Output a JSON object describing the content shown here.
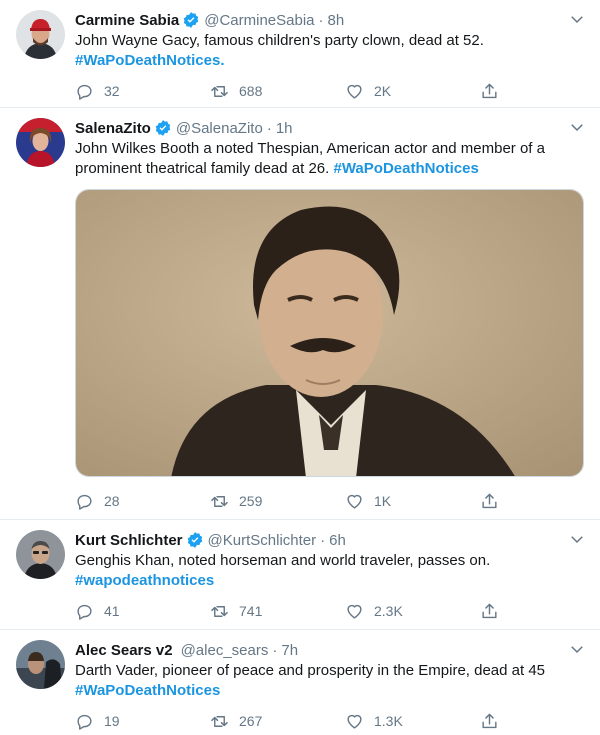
{
  "tweets": [
    {
      "name": "Carmine Sabia",
      "handle": "@CarmineSabia",
      "time": "8h",
      "text": "John Wayne Gacy, famous children's party clown, dead at 52.",
      "hashtag": "#WaPoDeathNotices",
      "hashtag_suffix": ".",
      "replies": "32",
      "retweets": "688",
      "likes": "2K"
    },
    {
      "name": "SalenaZito",
      "handle": "@SalenaZito",
      "time": "1h",
      "text": "John Wilkes Booth a noted Thespian, American actor and member of a prominent theatrical family dead at 26.",
      "hashtag": "#WaPoDeathNotices",
      "hashtag_suffix": "",
      "replies": "28",
      "retweets": "259",
      "likes": "1K"
    },
    {
      "name": "Kurt Schlichter",
      "handle": "@KurtSchlichter",
      "time": "6h",
      "text": "Genghis Khan, noted horseman and world traveler, passes on.",
      "hashtag": "#wapodeathnotices",
      "hashtag_suffix": "",
      "replies": "41",
      "retweets": "741",
      "likes": "2.3K"
    },
    {
      "name": "Alec Sears v2",
      "handle": "@alec_sears",
      "time": "7h",
      "text": "Darth Vader, pioneer of peace and prosperity in the Empire, dead at 45",
      "hashtag": "#WaPoDeathNotices",
      "hashtag_suffix": "",
      "replies": "19",
      "retweets": "267",
      "likes": "1.3K"
    }
  ],
  "separator": "·",
  "colors": {
    "hashtag": "#1b95e0",
    "verified": "#1da1f2",
    "muted": "#657786",
    "divider": "#e6ecf0"
  },
  "icons": [
    "verified-badge-icon",
    "chevron-down-icon",
    "reply-icon",
    "retweet-icon",
    "like-icon",
    "share-icon"
  ]
}
